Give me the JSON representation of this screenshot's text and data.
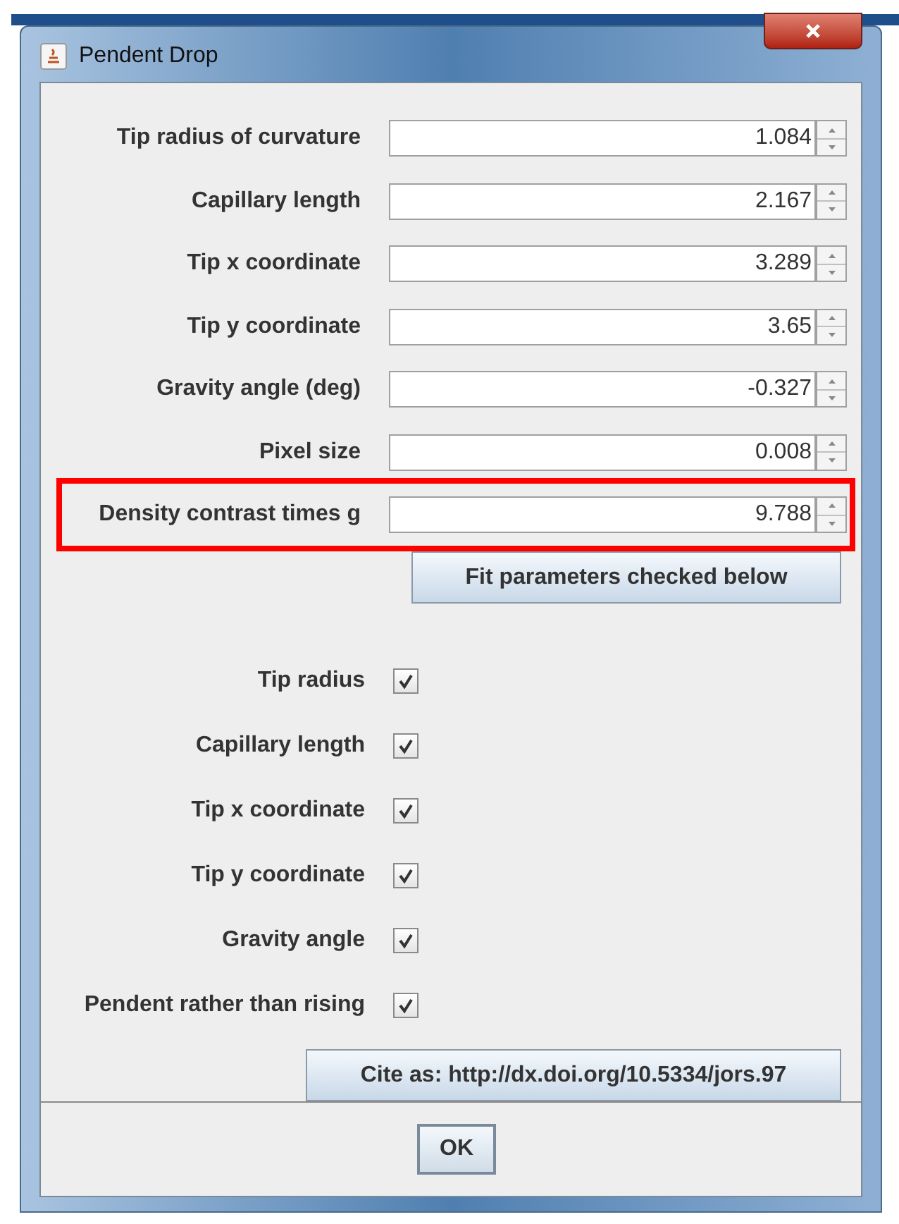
{
  "window": {
    "title": "Pendent Drop"
  },
  "fields": [
    {
      "label": "Tip radius of curvature",
      "value": "1.084",
      "highlighted": false
    },
    {
      "label": "Capillary length",
      "value": "2.167",
      "highlighted": false
    },
    {
      "label": "Tip x coordinate",
      "value": "3.289",
      "highlighted": false
    },
    {
      "label": "Tip y coordinate",
      "value": "3.65",
      "highlighted": false
    },
    {
      "label": "Gravity angle (deg)",
      "value": "-0.327",
      "highlighted": false
    },
    {
      "label": "Pixel size",
      "value": "0.008",
      "highlighted": false
    },
    {
      "label": "Density contrast times g",
      "value": "9.788",
      "highlighted": true
    }
  ],
  "fit_button": "Fit parameters checked below",
  "checkboxes": [
    {
      "label": "Tip radius",
      "checked": true
    },
    {
      "label": "Capillary length",
      "checked": true
    },
    {
      "label": "Tip x coordinate",
      "checked": true
    },
    {
      "label": "Tip y coordinate",
      "checked": true
    },
    {
      "label": "Gravity angle",
      "checked": true
    },
    {
      "label": "Pendent rather than rising",
      "checked": true
    }
  ],
  "cite_button": "Cite as: http://dx.doi.org/10.5334/jors.97",
  "ok_button": "OK"
}
